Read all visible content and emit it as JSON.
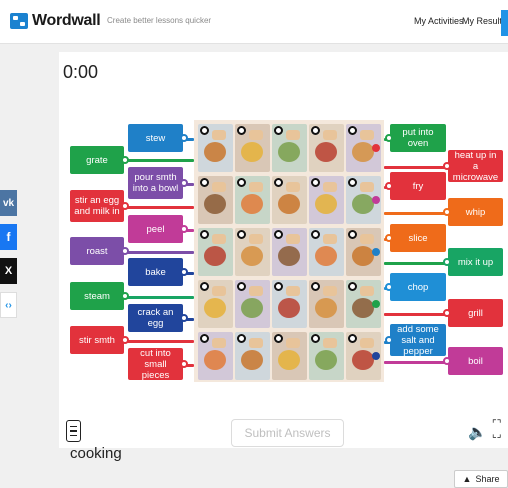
{
  "header": {
    "logo_text": "Wordwall",
    "tagline": "Create better lessons quicker",
    "nav": [
      "My Activities",
      "My Results"
    ]
  },
  "social": {
    "vk": "vk",
    "facebook": "f",
    "x": "X",
    "other": "‹›"
  },
  "game": {
    "timer": "0:00",
    "submit_label": "Submit Answers",
    "left_outer": [
      "grate",
      "stir an egg and milk in",
      "roast",
      "steam",
      "stir smth"
    ],
    "left_inner": [
      "stew",
      "pour smth into a bowl",
      "peel",
      "bake",
      "crack an egg",
      "cut into small pieces"
    ],
    "right_inner": [
      "put into oven",
      "fry",
      "slice",
      "chop",
      "add some salt and pepper"
    ],
    "right_outer": [
      "heat up in a microwave",
      "whip",
      "mix it up",
      "grill",
      "boil"
    ]
  },
  "footer": {
    "activity_title": "cooking",
    "share_label": "Share"
  },
  "colors": {
    "accent": "#2193e6",
    "green": "#1fa24a",
    "blue": "#1f80c8",
    "purple": "#7c4ea8",
    "pink": "#c13b98",
    "red": "#e2323c",
    "orange": "#ef6b1a"
  }
}
